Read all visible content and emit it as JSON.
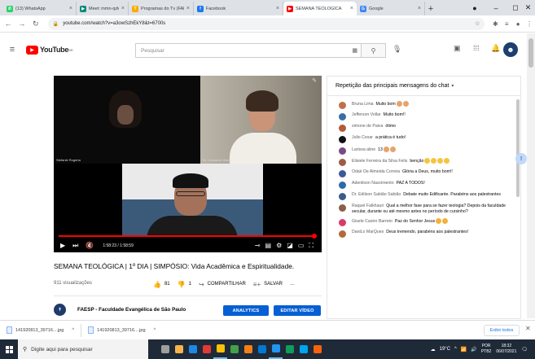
{
  "browser": {
    "tabs": [
      {
        "title": "(13) WhatsApp",
        "color": "#25d366",
        "glyph": "✆",
        "active": false,
        "width": 90
      },
      {
        "title": "Meet: mmn-qzkv",
        "color": "#00897b",
        "glyph": "▶",
        "active": false,
        "width": 64
      },
      {
        "title": "Programas do Tv (FAE",
        "color": "#f9ab00",
        "glyph": "T",
        "active": false,
        "width": 80
      },
      {
        "title": "Facebook",
        "color": "#1877f2",
        "glyph": "f",
        "active": false,
        "width": 110
      },
      {
        "title": "SEMANA TEOLÓGICA",
        "color": "#ff0000",
        "glyph": "▶",
        "active": true,
        "width": 90
      },
      {
        "title": "Google",
        "color": "#4285f4",
        "glyph": "G",
        "active": false,
        "width": 84
      }
    ],
    "url": "youtube.com/watch?v=a3owSzhEkY8&t=6700s"
  },
  "youtube": {
    "logo_text": "YouTube",
    "logo_country": "BR",
    "search_placeholder": "Pesquisar"
  },
  "video": {
    "time_label": "1:58:23 / 1:58:59",
    "progress_fraction": 0.99,
    "participant_names": [
      "Stefanie Rogeria",
      "Dr. Leonardo Gaida",
      ""
    ],
    "title": "SEMANA TEOLÓGICA | 1º DIA | SIMPÓSIO: Vida Acadêmica e Espiritualidade.",
    "views": "911 visualizações",
    "likes": "81",
    "dislikes": "1",
    "share_label": "COMPARTILHAR",
    "save_label": "SALVAR",
    "more_label": "…",
    "channel_name": "FAESP - Faculdade Evangélica de São Paulo",
    "analytics_label": "ANALYTICS",
    "edit_label": "EDITAR VÍDEO"
  },
  "chat": {
    "header": "Repetição das principais mensagens do chat",
    "messages": [
      {
        "author": "Bruna Lima",
        "text": "Muito bom",
        "color": "#c0704b",
        "emoji": "hand",
        "emoji_count": 2
      },
      {
        "author": "Jefferson Vollar",
        "text": "Muito bom!!",
        "color": "#3b6ea5",
        "emoji": "",
        "emoji_count": 0
      },
      {
        "author": "simone de Paiva",
        "text": "ótimo",
        "color": "#b55a3a",
        "emoji": "",
        "emoji_count": 0
      },
      {
        "author": "Julio Cesar",
        "text": "a prática é tudo!",
        "color": "#111111",
        "emoji": "",
        "emoji_count": 0
      },
      {
        "author": "Larissa aline",
        "text": "13",
        "color": "#7a4a86",
        "emoji": "hand",
        "emoji_count": 2
      },
      {
        "author": "Elisiele Ferreira da Silva Felix",
        "text": "benção",
        "color": "#a05b48",
        "emoji": "hands",
        "emoji_count": 4
      },
      {
        "author": "Odair De Almeida Correia",
        "text": "Glória a Deus, muito bom!!",
        "color": "#3c5a9a",
        "emoji": "",
        "emoji_count": 0
      },
      {
        "author": "Adenilson Nascimento",
        "text": "PAZ A TODOS!",
        "color": "#2d6aa7",
        "emoji": "",
        "emoji_count": 0
      },
      {
        "author": "Dr. Edilson Sabião Sabião",
        "text": "Debate muito Edificante. Parabéns aos palestrantes",
        "color": "#3b5b8a",
        "emoji": "",
        "emoji_count": 0
      },
      {
        "author": "Raquel Falkhauri",
        "text": "Qual a melhor fase para se fazer teologia? Depois da faculdade secular, durante ou até mesmo antes no período de cursinho?",
        "color": "#8b5e4a",
        "emoji": "",
        "emoji_count": 0
      },
      {
        "author": "Gisele Castro Barreto",
        "text": "Paz do Senhor Jesus",
        "color": "#d93b6a",
        "emoji": "pray",
        "emoji_count": 2
      },
      {
        "author": "DaniLo MarQues",
        "text": "Deus tremendo, parabéns aos palestrantes!",
        "color": "#b26a3d",
        "emoji": "",
        "emoji_count": 0
      }
    ]
  },
  "downloads": {
    "items": [
      "141920813_39716....jpg",
      "141920813_39716....jpg"
    ],
    "show_all": "Exibir todos",
    "close": "✕"
  },
  "taskbar": {
    "search_placeholder": "Digite aqui para pesquisar",
    "weather": "19°C",
    "lang_top": "POR",
    "lang_bottom": "PTB2",
    "time": "18:32",
    "date": "06/07/2021",
    "apps": [
      "#9e9e9e",
      "#f6b44f",
      "#1e88e5",
      "#e53935",
      "#ffc107",
      "#43a047",
      "#f57f17",
      "#0078d4",
      "#2196f3",
      "#0f9d58",
      "#00a4ef",
      "#f7630c"
    ]
  }
}
